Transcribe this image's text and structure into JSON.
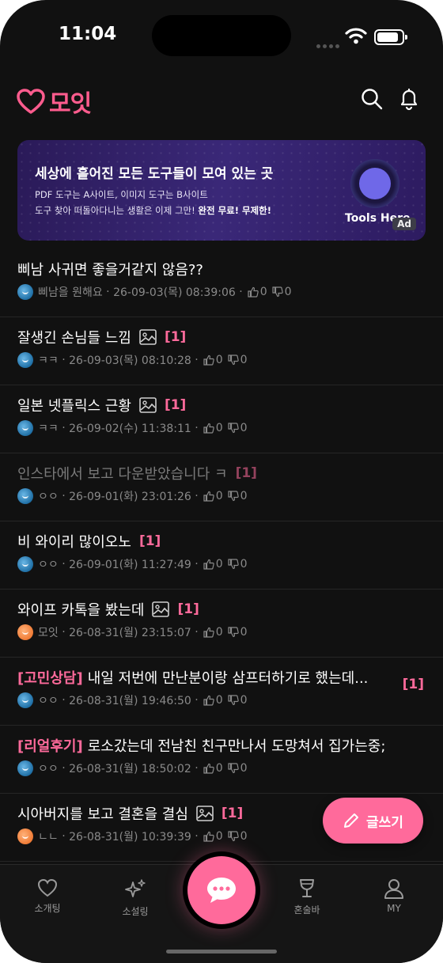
{
  "status": {
    "time": "11:04"
  },
  "app": {
    "logo_text": "모잇",
    "accent": "#ff6a9b"
  },
  "banner": {
    "title": "세상에 흩어진 모든 도구들이 모여 있는 곳",
    "line1": "PDF 도구는 A사이트, 이미지 도구는 B사이트",
    "line2_prefix": "도구 찾아 떠돌아다니는 생활은 이제 그만!",
    "line2_bold": "완전 무료! 무제한!",
    "brand": "Tools Here",
    "ad_label": "Ad"
  },
  "posts": [
    {
      "title": "삐남 사귀면 좋을거같지 않음??",
      "author": "삐남을 원해요",
      "date": "26-09-03(목) 08:39:06",
      "likes": "0",
      "dislikes": "0"
    },
    {
      "title": "잘생긴 손님들 느낌",
      "count": "[1]",
      "author": "ㅋㅋ",
      "date": "26-09-03(목) 08:10:28",
      "likes": "0",
      "dislikes": "0"
    },
    {
      "title": "일본 넷플릭스 근황",
      "count": "[1]",
      "author": "ㅋㅋ",
      "date": "26-09-02(수) 11:38:11",
      "likes": "0",
      "dislikes": "0"
    },
    {
      "title": "인스타에서 보고 다운받았습니다 ㅋ",
      "count": "[1]",
      "author": "ㅇㅇ",
      "date": "26-09-01(화) 23:01:26",
      "likes": "0",
      "dislikes": "0"
    },
    {
      "title": "비 와이리 많이오노",
      "count": "[1]",
      "author": "ㅇㅇ",
      "date": "26-09-01(화) 11:27:49",
      "likes": "0",
      "dislikes": "0"
    },
    {
      "title": "와이프 카톡을 봤는데",
      "count": "[1]",
      "author": "모잇",
      "date": "26-08-31(월) 23:15:07",
      "likes": "0",
      "dislikes": "0"
    },
    {
      "tag": "[고민상담]",
      "title": "내일 저번에 만난분이랑 삼프터하기로 했는데...",
      "count": "[1]",
      "author": "ㅇㅇ",
      "date": "26-08-31(월) 19:46:50",
      "likes": "0",
      "dislikes": "0"
    },
    {
      "tag": "[리얼후기]",
      "title": "로소갔는데 전남친 친구만나서 도망쳐서 집가는중;",
      "author": "ㅇㅇ",
      "date": "26-08-31(월) 18:50:02",
      "likes": "0",
      "dislikes": "0"
    },
    {
      "title": "시아버지를 보고 결혼을 결심",
      "count": "[1]",
      "author": "ㄴㄴ",
      "date": "26-08-31(월) 10:39:39",
      "likes": "0",
      "dislikes": "0"
    }
  ],
  "fab": {
    "label": "글쓰기"
  },
  "tabs": [
    {
      "label": "소개팅"
    },
    {
      "label": "소설링"
    },
    {
      "label": "혼술바"
    },
    {
      "label": "MY"
    }
  ]
}
